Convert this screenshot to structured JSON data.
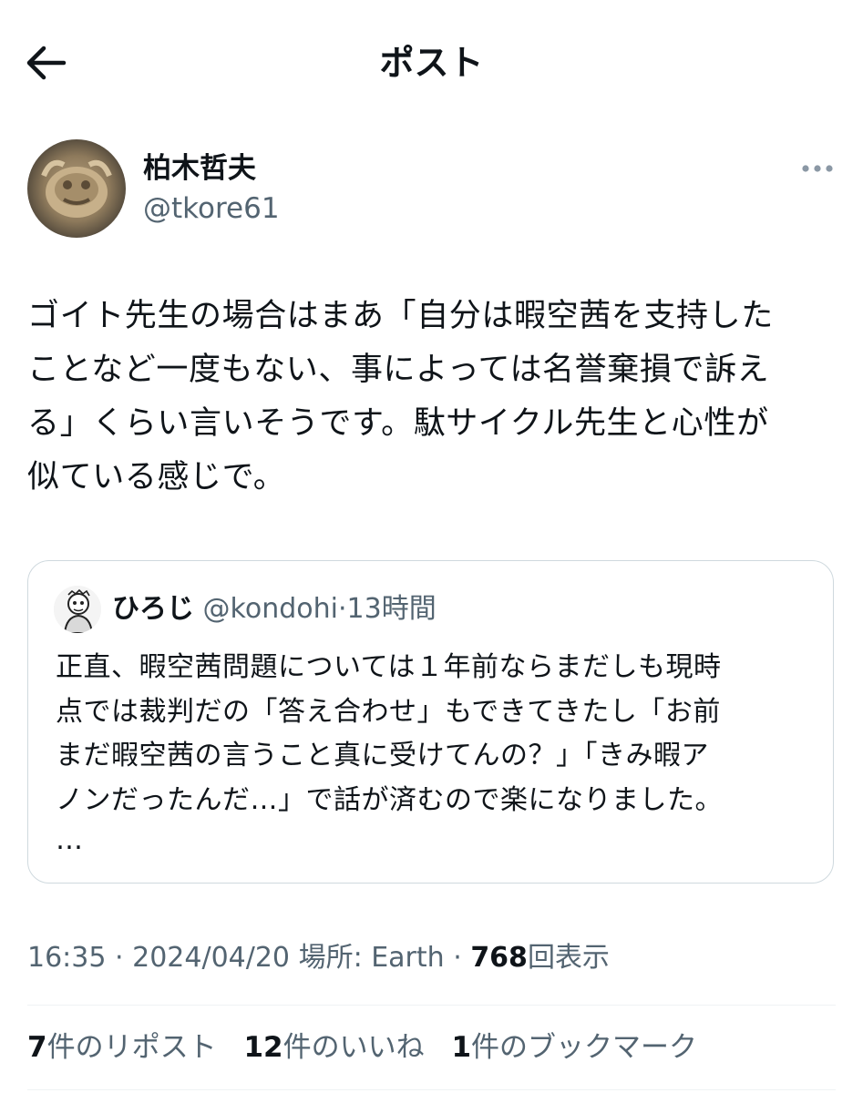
{
  "header": {
    "title": "ポスト",
    "back_icon": "arrow-left-icon"
  },
  "author": {
    "name": "柏木哲夫",
    "handle": "@tkore61",
    "more_icon": "more-horizontal-icon"
  },
  "post": {
    "lines": [
      "ゴイト先生の場合はまあ「自分は暇空茜を支持した",
      "ことなど一度もない、事によっては名誉棄損で訴え",
      "る」くらい言いそうです。駄サイクル先生と心性が",
      "似ている感じで。"
    ]
  },
  "quote": {
    "name": "ひろじ",
    "handle": "@kondohi",
    "separator": "·",
    "time": "13時間",
    "lines": [
      "正直、暇空茜問題については１年前ならまだしも現時",
      "点では裁判だの「答え合わせ」もできてきたし「お前",
      "まだ暇空茜の言うこと真に受けてんの？」「きみ暇ア",
      "ノンだったんだ…」で話が済むので楽になりました。"
    ],
    "more": "…"
  },
  "meta": {
    "time": "16:35",
    "sep1": "·",
    "date": "2024/04/20",
    "location": "場所: Earth",
    "sep2": "·",
    "views": "768",
    "views_label": "回表示"
  },
  "stats": {
    "reposts": "7",
    "reposts_label": "件のリポスト",
    "likes": "12",
    "likes_label": "件のいいね",
    "bookmarks": "1",
    "bookmarks_label": "件のブックマーク"
  },
  "colors": {
    "text": "#0f1419",
    "secondary": "#536471",
    "border": "#cfd9de",
    "divider": "#eff3f4"
  }
}
